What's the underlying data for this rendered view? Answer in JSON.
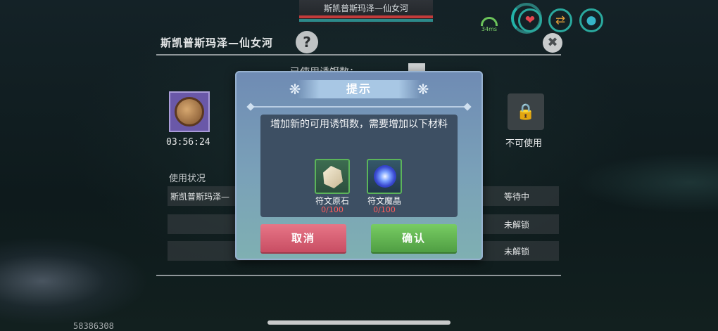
{
  "header": {
    "location": "斯凯普斯玛泽—仙女河",
    "network": "34ms"
  },
  "panel": {
    "title": "斯凯普斯玛泽—仙女河",
    "help_icon": "?",
    "lure_timer": "03:56:24",
    "locked_label": "不可使用",
    "usage_title": "使用状况",
    "rows": [
      {
        "name": "斯凯普斯玛泽—",
        "status": "等待中"
      },
      {
        "name": "",
        "status": "未解锁"
      },
      {
        "name": "",
        "status": "未解锁"
      }
    ],
    "behind_text": "已使用诱饵数：",
    "player_id": "58386308"
  },
  "dialog": {
    "title": "提示",
    "message": "增加新的可用诱饵数，需要增加以下材料",
    "materials": [
      {
        "name": "符文原石",
        "count": "0/100"
      },
      {
        "name": "符文魔晶",
        "count": "0/100"
      }
    ],
    "cancel_label": "取消",
    "confirm_label": "确认"
  },
  "icons": {
    "heart": "heart-icon",
    "swap": "swap-icon",
    "drop": "water-drop-icon",
    "lock": "lock-icon",
    "close": "close-icon"
  },
  "colors": {
    "cancel": "#d85c72",
    "confirm": "#5fb04f",
    "material_count": "#ff5c5c"
  }
}
